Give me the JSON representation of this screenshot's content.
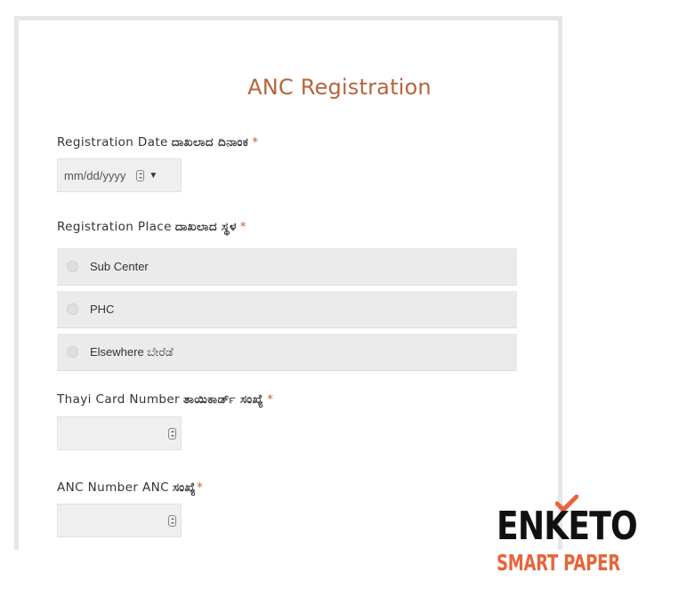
{
  "form": {
    "title": "ANC Registration",
    "required_marker": "*",
    "questions": {
      "registration_date": {
        "label": "Registration Date",
        "label_kn": "ದಾಖಲಾದ ದಿನಾಂಕ",
        "placeholder": "mm/dd/yyyy",
        "dropdown_arrow": "▼"
      },
      "registration_place": {
        "label": "Registration Place",
        "label_kn": "ದಾಖಲಾದ ಸ್ಥಳ",
        "options": [
          {
            "label": "Sub Center"
          },
          {
            "label": "PHC"
          },
          {
            "label": "Elsewhere ಬೇರೆಡೆ"
          }
        ]
      },
      "thayi_card_number": {
        "label": "Thayi Card Number",
        "label_kn": "ತಾಯಿಕಾರ್ಡ್ ಸಂಖ್ಯೆ"
      },
      "anc_number": {
        "label": "ANC Number ANC",
        "label_kn": "ಸಂಖ್ಯೆ"
      }
    }
  },
  "logo": {
    "main": "ENKETO",
    "sub": "SMART PAPER",
    "main_color": "#111111",
    "accent_color": "#e8643a"
  },
  "colors": {
    "title": "#b7643a",
    "required": "#b7643a",
    "option_background": "#ebebeb"
  },
  "icons": {
    "date_spinner": "spinner-icon",
    "dropdown": "chevron-down-icon",
    "radio": "radio-icon",
    "logo_check": "check-icon"
  }
}
